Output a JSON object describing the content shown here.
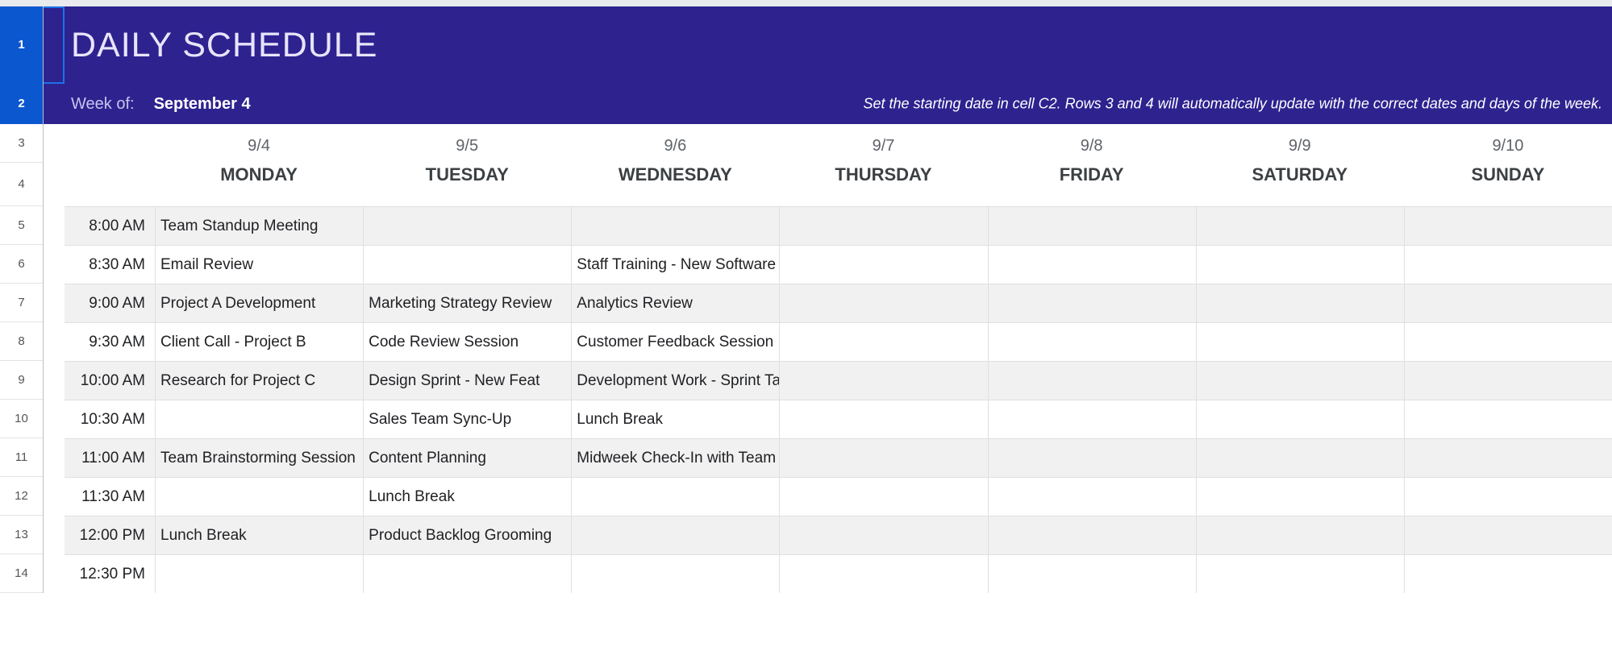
{
  "rowNumbers": [
    "1",
    "2",
    "3",
    "4",
    "5",
    "6",
    "7",
    "8",
    "9",
    "10",
    "11",
    "12",
    "13",
    "14"
  ],
  "header": {
    "title": "DAILY SCHEDULE",
    "weekOfLabel": "Week of:",
    "weekOfDate": "September 4",
    "hint": "Set the starting date in cell C2. Rows 3 and 4 will automatically update with the correct dates and days of the week."
  },
  "days": [
    {
      "date": "9/4",
      "name": "MONDAY"
    },
    {
      "date": "9/5",
      "name": "TUESDAY"
    },
    {
      "date": "9/6",
      "name": "WEDNESDAY"
    },
    {
      "date": "9/7",
      "name": "THURSDAY"
    },
    {
      "date": "9/8",
      "name": "FRIDAY"
    },
    {
      "date": "9/9",
      "name": "SATURDAY"
    },
    {
      "date": "9/10",
      "name": "SUNDAY"
    }
  ],
  "slots": [
    {
      "time": "8:00 AM",
      "events": [
        "Team Standup Meeting",
        "",
        "",
        "",
        "",
        "",
        ""
      ]
    },
    {
      "time": "8:30 AM",
      "events": [
        "Email Review",
        "",
        "Staff Training - New Software",
        "",
        "",
        "",
        ""
      ]
    },
    {
      "time": "9:00 AM",
      "events": [
        "Project A Development",
        "Marketing Strategy Review",
        "Analytics Review",
        "",
        "",
        "",
        ""
      ]
    },
    {
      "time": "9:30 AM",
      "events": [
        "Client Call - Project B",
        "Code Review Session",
        "Customer Feedback Session",
        "",
        "",
        "",
        ""
      ]
    },
    {
      "time": "10:00 AM",
      "events": [
        "Research for Project C",
        "Design Sprint - New Feat",
        "Development Work - Sprint Tasks",
        "",
        "",
        "",
        ""
      ]
    },
    {
      "time": "10:30 AM",
      "events": [
        "",
        "Sales Team Sync-Up",
        "Lunch Break",
        "",
        "",
        "",
        ""
      ]
    },
    {
      "time": "11:00 AM",
      "events": [
        "Team Brainstorming Session",
        "Content Planning",
        "Midweek Check-In with Team",
        "",
        "",
        "",
        ""
      ]
    },
    {
      "time": "11:30 AM",
      "events": [
        "",
        "Lunch Break",
        "",
        "",
        "",
        "",
        ""
      ]
    },
    {
      "time": "12:00 PM",
      "events": [
        "Lunch Break",
        "Product Backlog Grooming",
        "",
        "",
        "",
        "",
        ""
      ]
    },
    {
      "time": "12:30 PM",
      "events": [
        "",
        "",
        "",
        "",
        "",
        "",
        ""
      ]
    }
  ]
}
